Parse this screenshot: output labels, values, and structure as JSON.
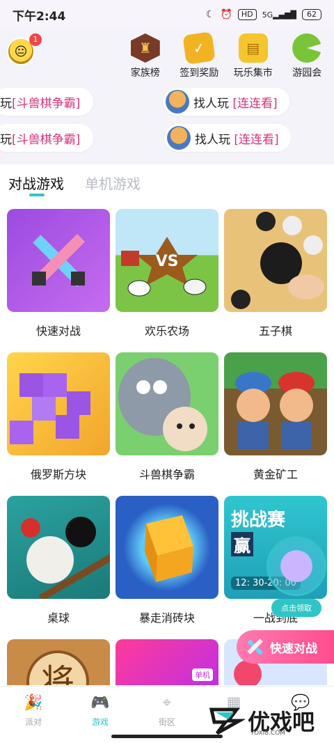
{
  "status_bar": {
    "time": "下午2:44",
    "hd": "HD",
    "network": "5G",
    "battery": "62"
  },
  "header": {
    "avatar_badge": "1",
    "menu": [
      {
        "label": "家族榜",
        "icon": "family-rank-icon",
        "color": "#7a3a28"
      },
      {
        "label": "签到奖励",
        "icon": "checkin-reward-icon",
        "color": "#f2b323"
      },
      {
        "label": "玩乐集市",
        "icon": "market-icon",
        "color": "#f5c52d"
      },
      {
        "label": "游园会",
        "icon": "pacman-icon",
        "color": "#7ac43a"
      }
    ],
    "find_cards": [
      {
        "prefix": "玩",
        "tag": "[斗兽棋争霸]"
      },
      {
        "prefix": "找人玩",
        "tag": "[连连看]"
      },
      {
        "prefix": "玩",
        "tag": "[斗兽棋争霸]"
      },
      {
        "prefix": "找人玩",
        "tag": "[连连看]"
      }
    ]
  },
  "tabs": {
    "versus": "对战游戏",
    "single": "单机游戏"
  },
  "games": [
    {
      "name": "快速对战"
    },
    {
      "name": "欢乐农场",
      "art_text": "VS"
    },
    {
      "name": "五子棋"
    },
    {
      "name": "俄罗斯方块"
    },
    {
      "name": "斗兽棋争霸"
    },
    {
      "name": "黄金矿工"
    },
    {
      "name": "桌球"
    },
    {
      "name": "暴走消砖块"
    },
    {
      "name": "一战到底",
      "art_text_1": "挑战赛",
      "art_text_2": "赢",
      "art_time": "12: 30-20: 00"
    }
  ],
  "row4": {
    "chess_char": "将",
    "badge": "单机"
  },
  "floating": {
    "claim": "点击领取",
    "quick_fight": "快速对战"
  },
  "nav": [
    {
      "label": "派对",
      "icon": "party-icon"
    },
    {
      "label": "游戏",
      "icon": "game-icon"
    },
    {
      "label": "街区",
      "icon": "location-icon"
    },
    {
      "label": "",
      "icon": "grid-icon"
    },
    {
      "label": "",
      "icon": "chat-icon"
    }
  ],
  "watermark": {
    "text": "优戏吧",
    "sub": "YOXI8.COM"
  }
}
